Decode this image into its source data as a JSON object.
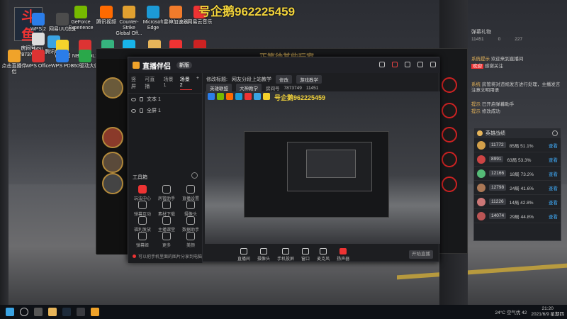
{
  "watermark": "号企鹅962225459",
  "logo": {
    "brand": "斗鱼",
    "room_label": "房间号",
    "room_id": "7873749"
  },
  "desktop_icons": [
    {
      "label": "WPS 2",
      "color": "#2b7de9"
    },
    {
      "label": "网易UU加速",
      "color": "#4c4c4c"
    },
    {
      "label": "GeForce Experience",
      "color": "#76b900"
    },
    {
      "label": "腾讯视频",
      "color": "#ff6a00"
    },
    {
      "label": "Counter-Strike Global Off...",
      "color": "#e0a030"
    },
    {
      "label": "Microsoft Edge",
      "color": "#1c9ad6"
    },
    {
      "label": "雷神加速器",
      "color": "#f17b2b"
    },
    {
      "label": "网易云音乐",
      "color": "#e33"
    },
    {
      "label": "腾讯QQ",
      "color": "#3aa3e3"
    },
    {
      "label": "MSI",
      "color": "#ddd"
    },
    {
      "label": "YY语音",
      "color": "#f4d22c"
    },
    {
      "label": "NBA2KOL2",
      "color": "#d33"
    },
    {
      "label": "QQ音乐",
      "color": "#36b37e"
    },
    {
      "label": "Logitech G HUB",
      "color": "#18b4e9"
    },
    {
      "label": "PUBG BATTLEGR...",
      "color": "#e7b55a"
    },
    {
      "label": "WeGame",
      "color": "#e33"
    },
    {
      "label": "网易云音乐",
      "color": "#c22"
    },
    {
      "label": "点击直播伴侣",
      "color": "#f0a32a"
    },
    {
      "label": "WPS Office",
      "color": "#d33"
    },
    {
      "label": "WPS PDF",
      "color": "#2b7de9"
    },
    {
      "label": "360驱动大师",
      "color": "#2aa84a"
    }
  ],
  "bg_app": {
    "title": "正等待某些玩家"
  },
  "dialog": {
    "title": "直播伴侣",
    "version": "新版",
    "tabs": [
      "竖屏",
      "可直播",
      "场景1",
      "场景2"
    ],
    "scenes": [
      "文本 1",
      "全屏 1"
    ],
    "tools_title": "工具箱",
    "tools": [
      {
        "label": "玩法中心",
        "red": true
      },
      {
        "label": "房管助手",
        "red": false
      },
      {
        "label": "直播设置",
        "red": false
      },
      {
        "label": "弹幕互动",
        "red": false
      },
      {
        "label": "素材下载",
        "red": false
      },
      {
        "label": "摄像头",
        "red": false
      },
      {
        "label": "福利发放",
        "red": false
      },
      {
        "label": "主播课堂",
        "red": false
      },
      {
        "label": "数据助手",
        "red": false
      },
      {
        "label": "弹幕姬",
        "red": false
      },
      {
        "label": "更多",
        "red": false
      },
      {
        "label": "美颜",
        "red": false
      }
    ],
    "bottom_tip": "可以把手机里面的图片分享到电脑",
    "info": {
      "title_label": "修改标题:",
      "title_value": "网友分段上站教学",
      "edit": "修改",
      "game_btn": "游戏教学",
      "room_label": "房间号",
      "room_id": "7873749",
      "fans": "11451",
      "cat1": "英雄联盟",
      "cat2": "大神教学"
    },
    "controls": [
      "直播间",
      "摄像头",
      "手机投屏",
      "窗口",
      "麦克风",
      "扬声器"
    ],
    "start_button": "开始直播"
  },
  "chat": {
    "head": "弹幕礼物",
    "stats": [
      "11451",
      "0",
      "227"
    ],
    "lines": [
      {
        "name": "系统提示",
        "text": "欢迎来到直播间"
      },
      {
        "name": "欢迎",
        "text": "感谢关注"
      },
      {
        "name": "系统",
        "text": "房管将对违规发言进行处理，主播发言注意文明用语"
      },
      {
        "name": "提示",
        "text": "已开启弹幕助手"
      },
      {
        "name": "提示",
        "text": "修改成功"
      }
    ]
  },
  "hero_panel": {
    "title": "英雄战绩",
    "rows": [
      {
        "value": "11772",
        "stat": "85局 51.1%",
        "action": "查看",
        "color": "#d3a04a"
      },
      {
        "value": "8991",
        "stat": "63局 53.3%",
        "action": "查看",
        "color": "#c44"
      },
      {
        "value": "12166",
        "stat": "18局 73.2%",
        "action": "查看",
        "color": "#5b7"
      },
      {
        "value": "12798",
        "stat": "24局 41.6%",
        "action": "查看",
        "color": "#a75"
      },
      {
        "value": "11226",
        "stat": "14局 42.8%",
        "action": "查看",
        "color": "#c77"
      },
      {
        "value": "14074",
        "stat": "29局 44.8%",
        "action": "查看",
        "color": "#b55"
      }
    ]
  },
  "taskbar": {
    "weather": "24°C 空气优 42",
    "time": "21:20",
    "date": "2021/6/9 星期四"
  }
}
